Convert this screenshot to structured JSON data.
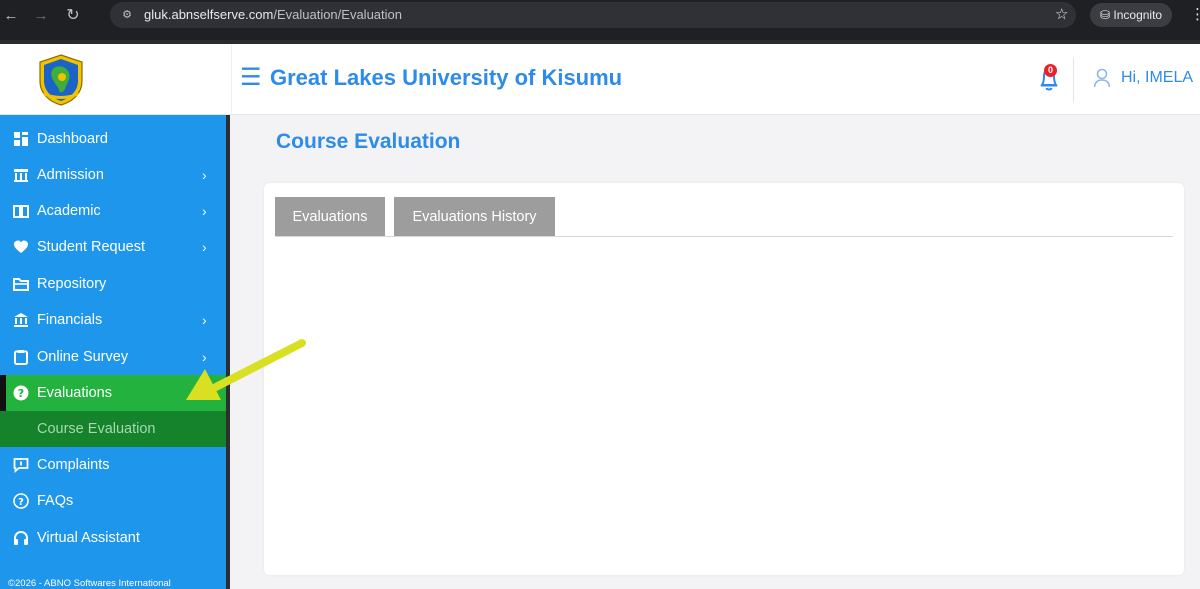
{
  "browser": {
    "url_domain": "gluk.abnselfserve.com",
    "url_path": "/Evaluation/Evaluation",
    "incognito_label": "Incognito",
    "icons": [
      "back-arrow-icon",
      "forward-arrow-icon",
      "reload-icon",
      "site-info-icon",
      "bookmark-star-icon",
      "incognito-icon",
      "browser-menu-icon"
    ]
  },
  "header": {
    "university_name": "Great Lakes University of Kisumu",
    "notification_count": "0",
    "greeting": "Hi, IMELA",
    "brand_color": "#2d8be9"
  },
  "sidebar": {
    "background_color": "#1d96ec",
    "active_color": "#24b23f",
    "items": [
      {
        "label": "Dashboard",
        "icon": "dashboard-grid-icon",
        "has_submenu": false
      },
      {
        "label": "Admission",
        "icon": "institution-icon",
        "has_submenu": true
      },
      {
        "label": "Academic",
        "icon": "book-icon",
        "has_submenu": true
      },
      {
        "label": "Student Request",
        "icon": "heart-hand-icon",
        "has_submenu": true
      },
      {
        "label": "Repository",
        "icon": "folder-icon",
        "has_submenu": false
      },
      {
        "label": "Financials",
        "icon": "bank-icon",
        "has_submenu": true
      },
      {
        "label": "Online Survey",
        "icon": "clipboard-icon",
        "has_submenu": true
      },
      {
        "label": "Evaluations",
        "icon": "question-circle-icon",
        "has_submenu": true,
        "active": true
      },
      {
        "label": "Complaints",
        "icon": "message-square-icon",
        "has_submenu": false
      },
      {
        "label": "FAQs",
        "icon": "help-circle-icon",
        "has_submenu": false
      },
      {
        "label": "Virtual Assistant",
        "icon": "headphones-icon",
        "has_submenu": false
      }
    ],
    "subitem": {
      "label": "Course Evaluation",
      "active": true
    },
    "footer": "©2026 - ABNO Softwares International"
  },
  "main": {
    "page_title": "Course Evaluation",
    "tabs": [
      {
        "label": "Evaluations"
      },
      {
        "label": "Evaluations History"
      }
    ]
  }
}
